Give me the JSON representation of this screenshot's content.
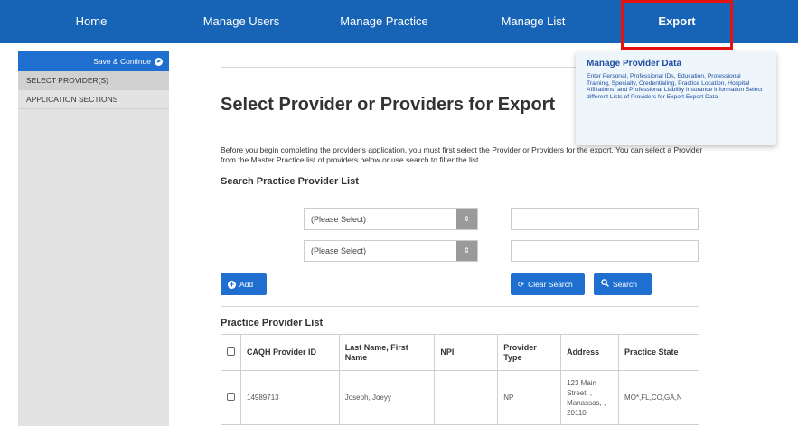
{
  "nav": {
    "home": "Home",
    "manage_users": "Manage Users",
    "manage_practice": "Manage Practice",
    "manage_list": "Manage List",
    "export": "Export"
  },
  "sidebar": {
    "save_continue": "Save & Continue",
    "items": [
      {
        "label": "SELECT PROVIDER(S)"
      },
      {
        "label": "APPLICATION SECTIONS"
      }
    ]
  },
  "page": {
    "title": "Select Provider or Providers for Export",
    "intro": "Before you begin completing the provider's application, you must first select the Provider or Providers for the export. You can select a Provider from the Master Practice list of providers below or use search to filter the list."
  },
  "search": {
    "title": "Search Practice Provider List",
    "select1": "(Please Select)",
    "select2": "(Please Select)",
    "input1": "",
    "input2": "",
    "add_label": "Add",
    "clear_label": "Clear Search",
    "search_label": "Search"
  },
  "list": {
    "title": "Practice Provider List",
    "columns": [
      "CAQH Provider ID",
      "Last Name, First Name",
      "NPI",
      "Provider Type",
      "Address",
      "Practice State"
    ],
    "rows": [
      {
        "caqh_id": "14989713",
        "name": "Joseph, Joeyy",
        "npi": "",
        "provider_type": "NP",
        "address": "123 Main Street, , Manassas, , 20110",
        "practice_state": "MO*,FL,CO,GA,N"
      }
    ]
  },
  "dropdown": {
    "title": "Manage Provider Data",
    "description": "Enter Personal, Professional IDs, Education, Professional Training, Specialty, Credentialing, Practice Location, Hospital Affiliations, and Professional Liability Insurance information Select different Lists of Providers for Export Export Data"
  },
  "colors": {
    "nav_bg": "#1763b5",
    "button_blue": "#1f6fd0",
    "highlight_red": "#e3140f",
    "sidebar_bg": "#e2e2e2",
    "dropdown_bg": "#eef6fb"
  },
  "icons": {
    "save_arrow": "arrow-right-circle-icon",
    "add": "plus-circle-icon",
    "clear": "refresh-icon",
    "search": "magnifier-icon",
    "select_caret": "updown-caret-icon"
  }
}
